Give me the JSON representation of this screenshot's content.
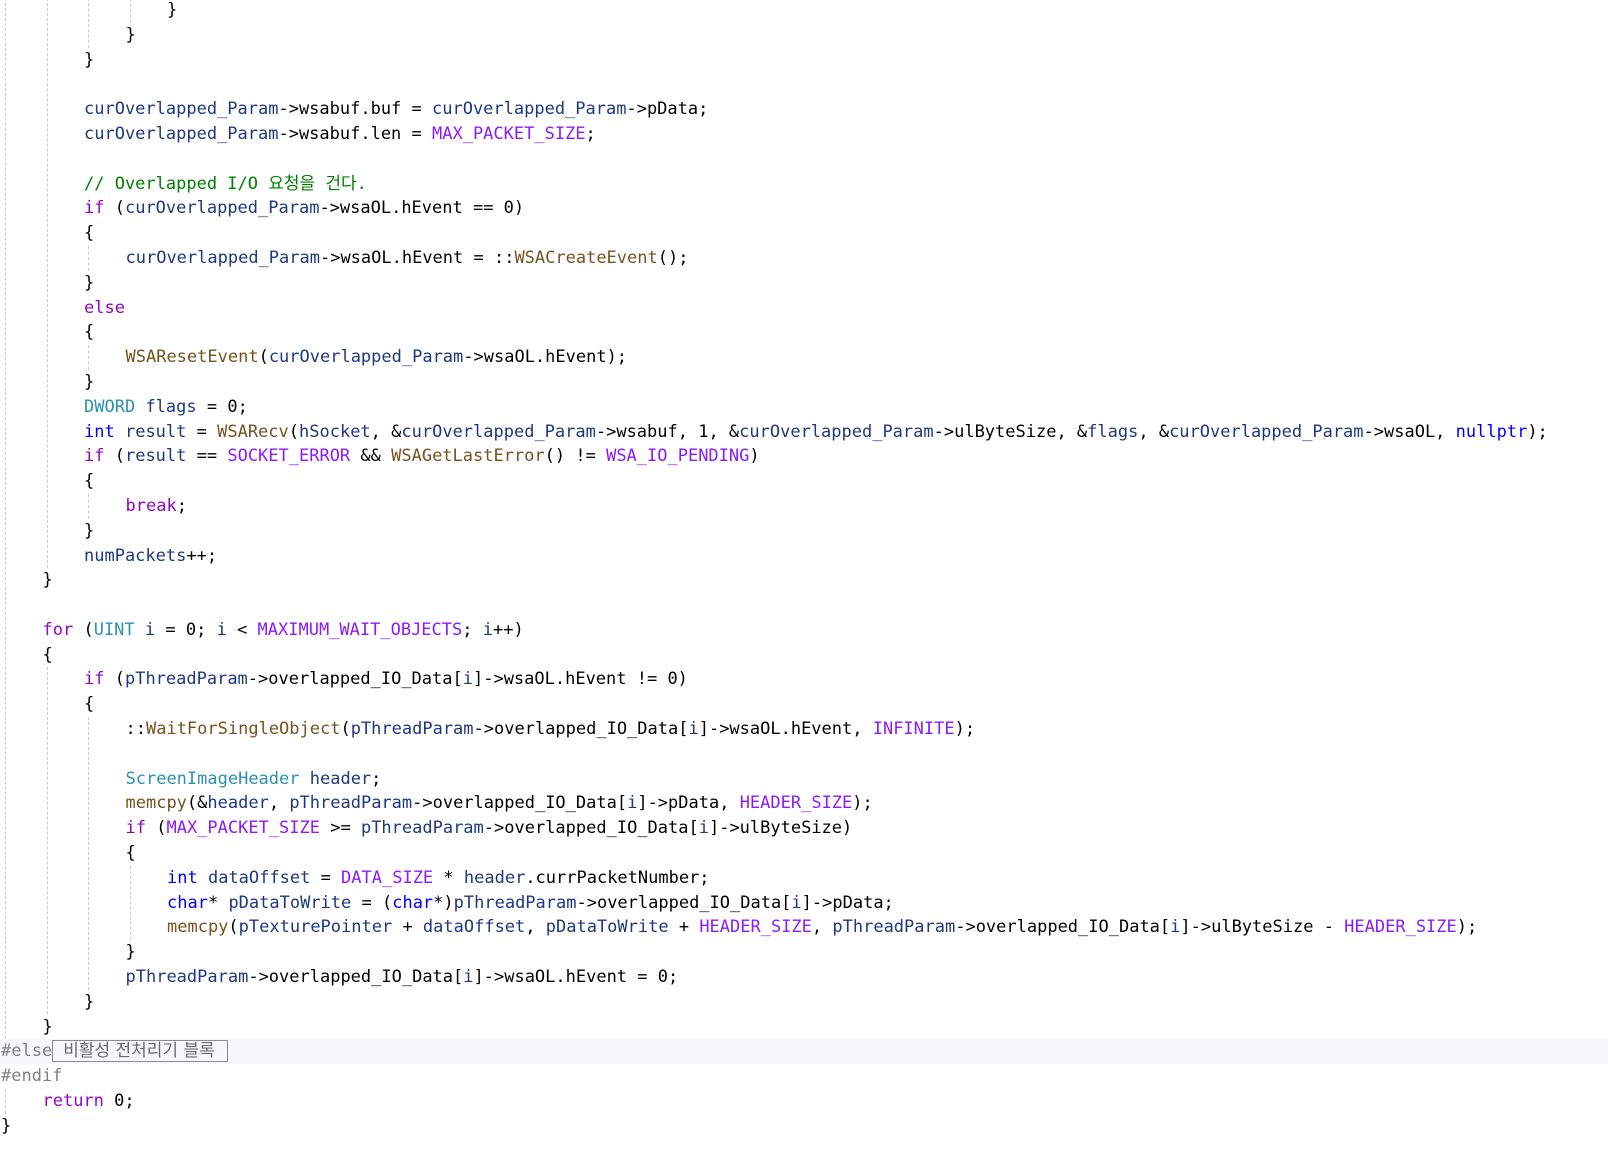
{
  "colors": {
    "plain": "#000000",
    "keyword": "#0000ff",
    "control": "#8f08c4",
    "type": "#2b91af",
    "variable": "#1f377f",
    "function": "#74531f",
    "macro": "#8a1bff",
    "comment": "#008000",
    "preprocessor": "#808080",
    "hint": "#6b6b6b",
    "number": "#000000"
  },
  "hint": {
    "label": "비활성 전처리기 블록"
  },
  "lines": [
    {
      "indent": 4,
      "tokens": [
        {
          "t": "}"
        }
      ]
    },
    {
      "indent": 3,
      "tokens": [
        {
          "t": "}"
        }
      ]
    },
    {
      "indent": 2,
      "tokens": [
        {
          "t": "}"
        }
      ]
    },
    {
      "indent": 0,
      "tokens": []
    },
    {
      "indent": 2,
      "tokens": [
        {
          "t": "curOverlapped_Param",
          "c": "variable"
        },
        {
          "t": "->wsabuf.buf = "
        },
        {
          "t": "curOverlapped_Param",
          "c": "variable"
        },
        {
          "t": "->pData;"
        }
      ]
    },
    {
      "indent": 2,
      "tokens": [
        {
          "t": "curOverlapped_Param",
          "c": "variable"
        },
        {
          "t": "->wsabuf.len = "
        },
        {
          "t": "MAX_PACKET_SIZE",
          "c": "macro"
        },
        {
          "t": ";"
        }
      ]
    },
    {
      "indent": 0,
      "tokens": []
    },
    {
      "indent": 2,
      "tokens": [
        {
          "t": "// Overlapped I/O 요청을 건다.",
          "c": "comment"
        }
      ]
    },
    {
      "indent": 2,
      "tokens": [
        {
          "t": "if",
          "c": "control"
        },
        {
          "t": " ("
        },
        {
          "t": "curOverlapped_Param",
          "c": "variable"
        },
        {
          "t": "->wsaOL.hEvent == 0)"
        }
      ]
    },
    {
      "indent": 2,
      "tokens": [
        {
          "t": "{"
        }
      ]
    },
    {
      "indent": 3,
      "tokens": [
        {
          "t": "curOverlapped_Param",
          "c": "variable"
        },
        {
          "t": "->wsaOL.hEvent = ::"
        },
        {
          "t": "WSACreateEvent",
          "c": "function"
        },
        {
          "t": "();"
        }
      ]
    },
    {
      "indent": 2,
      "tokens": [
        {
          "t": "}"
        }
      ]
    },
    {
      "indent": 2,
      "tokens": [
        {
          "t": "else",
          "c": "control"
        }
      ]
    },
    {
      "indent": 2,
      "tokens": [
        {
          "t": "{"
        }
      ]
    },
    {
      "indent": 3,
      "tokens": [
        {
          "t": "WSAResetEvent",
          "c": "function"
        },
        {
          "t": "("
        },
        {
          "t": "curOverlapped_Param",
          "c": "variable"
        },
        {
          "t": "->wsaOL.hEvent);"
        }
      ]
    },
    {
      "indent": 2,
      "tokens": [
        {
          "t": "}"
        }
      ]
    },
    {
      "indent": 2,
      "tokens": [
        {
          "t": "DWORD",
          "c": "type"
        },
        {
          "t": " "
        },
        {
          "t": "flags",
          "c": "variable"
        },
        {
          "t": " = 0;"
        }
      ]
    },
    {
      "indent": 2,
      "tokens": [
        {
          "t": "int",
          "c": "keyword"
        },
        {
          "t": " "
        },
        {
          "t": "result",
          "c": "variable"
        },
        {
          "t": " = "
        },
        {
          "t": "WSARecv",
          "c": "function"
        },
        {
          "t": "("
        },
        {
          "t": "hSocket",
          "c": "variable"
        },
        {
          "t": ", &"
        },
        {
          "t": "curOverlapped_Param",
          "c": "variable"
        },
        {
          "t": "->wsabuf, 1, &"
        },
        {
          "t": "curOverlapped_Param",
          "c": "variable"
        },
        {
          "t": "->ulByteSize, &"
        },
        {
          "t": "flags",
          "c": "variable"
        },
        {
          "t": ", &"
        },
        {
          "t": "curOverlapped_Param",
          "c": "variable"
        },
        {
          "t": "->wsaOL, "
        },
        {
          "t": "nullptr",
          "c": "keyword"
        },
        {
          "t": ");"
        }
      ]
    },
    {
      "indent": 2,
      "tokens": [
        {
          "t": "if",
          "c": "control"
        },
        {
          "t": " ("
        },
        {
          "t": "result",
          "c": "variable"
        },
        {
          "t": " == "
        },
        {
          "t": "SOCKET_ERROR",
          "c": "macro"
        },
        {
          "t": " && "
        },
        {
          "t": "WSAGetLastError",
          "c": "function"
        },
        {
          "t": "() != "
        },
        {
          "t": "WSA_IO_PENDING",
          "c": "macro"
        },
        {
          "t": ")"
        }
      ]
    },
    {
      "indent": 2,
      "tokens": [
        {
          "t": "{"
        }
      ]
    },
    {
      "indent": 3,
      "tokens": [
        {
          "t": "break",
          "c": "control"
        },
        {
          "t": ";"
        }
      ]
    },
    {
      "indent": 2,
      "tokens": [
        {
          "t": "}"
        }
      ]
    },
    {
      "indent": 2,
      "tokens": [
        {
          "t": "numPackets",
          "c": "variable"
        },
        {
          "t": "++;"
        }
      ]
    },
    {
      "indent": 1,
      "tokens": [
        {
          "t": "}"
        }
      ]
    },
    {
      "indent": 0,
      "tokens": [],
      "half": true
    },
    {
      "indent": 1,
      "tokens": [
        {
          "t": "for",
          "c": "control"
        },
        {
          "t": " ("
        },
        {
          "t": "UINT",
          "c": "type"
        },
        {
          "t": " "
        },
        {
          "t": "i",
          "c": "variable"
        },
        {
          "t": " = 0; "
        },
        {
          "t": "i",
          "c": "variable"
        },
        {
          "t": " < "
        },
        {
          "t": "MAXIMUM_WAIT_OBJECTS",
          "c": "macro"
        },
        {
          "t": "; "
        },
        {
          "t": "i",
          "c": "variable"
        },
        {
          "t": "++)"
        }
      ]
    },
    {
      "indent": 1,
      "tokens": [
        {
          "t": "{"
        }
      ]
    },
    {
      "indent": 2,
      "tokens": [
        {
          "t": "if",
          "c": "control"
        },
        {
          "t": " ("
        },
        {
          "t": "pThreadParam",
          "c": "variable"
        },
        {
          "t": "->overlapped_IO_Data["
        },
        {
          "t": "i",
          "c": "variable"
        },
        {
          "t": "]->wsaOL.hEvent != 0)"
        }
      ]
    },
    {
      "indent": 2,
      "tokens": [
        {
          "t": "{"
        }
      ]
    },
    {
      "indent": 3,
      "tokens": [
        {
          "t": "::"
        },
        {
          "t": "WaitForSingleObject",
          "c": "function"
        },
        {
          "t": "("
        },
        {
          "t": "pThreadParam",
          "c": "variable"
        },
        {
          "t": "->overlapped_IO_Data["
        },
        {
          "t": "i",
          "c": "variable"
        },
        {
          "t": "]->wsaOL.hEvent, "
        },
        {
          "t": "INFINITE",
          "c": "macro"
        },
        {
          "t": ");"
        }
      ]
    },
    {
      "indent": 0,
      "tokens": []
    },
    {
      "indent": 3,
      "tokens": [
        {
          "t": "ScreenImageHeader",
          "c": "type"
        },
        {
          "t": " "
        },
        {
          "t": "header",
          "c": "variable"
        },
        {
          "t": ";"
        }
      ]
    },
    {
      "indent": 3,
      "tokens": [
        {
          "t": "memcpy",
          "c": "function"
        },
        {
          "t": "(&"
        },
        {
          "t": "header",
          "c": "variable"
        },
        {
          "t": ", "
        },
        {
          "t": "pThreadParam",
          "c": "variable"
        },
        {
          "t": "->overlapped_IO_Data["
        },
        {
          "t": "i",
          "c": "variable"
        },
        {
          "t": "]->pData, "
        },
        {
          "t": "HEADER_SIZE",
          "c": "macro"
        },
        {
          "t": ");"
        }
      ]
    },
    {
      "indent": 3,
      "tokens": [
        {
          "t": "if",
          "c": "control"
        },
        {
          "t": " ("
        },
        {
          "t": "MAX_PACKET_SIZE",
          "c": "macro"
        },
        {
          "t": " >= "
        },
        {
          "t": "pThreadParam",
          "c": "variable"
        },
        {
          "t": "->overlapped_IO_Data["
        },
        {
          "t": "i",
          "c": "variable"
        },
        {
          "t": "]->ulByteSize)"
        }
      ]
    },
    {
      "indent": 3,
      "tokens": [
        {
          "t": "{"
        }
      ]
    },
    {
      "indent": 4,
      "tokens": [
        {
          "t": "int",
          "c": "keyword"
        },
        {
          "t": " "
        },
        {
          "t": "dataOffset",
          "c": "variable"
        },
        {
          "t": " = "
        },
        {
          "t": "DATA_SIZE",
          "c": "macro"
        },
        {
          "t": " * "
        },
        {
          "t": "header",
          "c": "variable"
        },
        {
          "t": ".currPacketNumber;"
        }
      ]
    },
    {
      "indent": 4,
      "tokens": [
        {
          "t": "char",
          "c": "keyword"
        },
        {
          "t": "* "
        },
        {
          "t": "pDataToWrite",
          "c": "variable"
        },
        {
          "t": " = ("
        },
        {
          "t": "char",
          "c": "keyword"
        },
        {
          "t": "*)"
        },
        {
          "t": "pThreadParam",
          "c": "variable"
        },
        {
          "t": "->overlapped_IO_Data["
        },
        {
          "t": "i",
          "c": "variable"
        },
        {
          "t": "]->pData;"
        }
      ]
    },
    {
      "indent": 4,
      "tokens": [
        {
          "t": "memcpy",
          "c": "function"
        },
        {
          "t": "("
        },
        {
          "t": "pTexturePointer",
          "c": "variable"
        },
        {
          "t": " + "
        },
        {
          "t": "dataOffset",
          "c": "variable"
        },
        {
          "t": ", "
        },
        {
          "t": "pDataToWrite",
          "c": "variable"
        },
        {
          "t": " + "
        },
        {
          "t": "HEADER_SIZE",
          "c": "macro"
        },
        {
          "t": ", "
        },
        {
          "t": "pThreadParam",
          "c": "variable"
        },
        {
          "t": "->overlapped_IO_Data["
        },
        {
          "t": "i",
          "c": "variable"
        },
        {
          "t": "]->ulByteSize - "
        },
        {
          "t": "HEADER_SIZE",
          "c": "macro"
        },
        {
          "t": ");"
        }
      ]
    },
    {
      "indent": 3,
      "tokens": [
        {
          "t": "}"
        }
      ]
    },
    {
      "indent": 3,
      "tokens": [
        {
          "t": "pThreadParam",
          "c": "variable"
        },
        {
          "t": "->overlapped_IO_Data["
        },
        {
          "t": "i",
          "c": "variable"
        },
        {
          "t": "]->wsaOL.hEvent = 0;"
        }
      ]
    },
    {
      "indent": 2,
      "tokens": [
        {
          "t": "}"
        }
      ]
    },
    {
      "indent": 1,
      "tokens": [
        {
          "t": "}"
        }
      ]
    },
    {
      "indent": 0,
      "tokens": [
        {
          "t": "#else",
          "c": "preprocessor"
        }
      ],
      "inactive": true,
      "hint": true
    },
    {
      "indent": 0,
      "tokens": [
        {
          "t": "#endif",
          "c": "preprocessor"
        }
      ]
    },
    {
      "indent": 1,
      "tokens": [
        {
          "t": "return",
          "c": "control"
        },
        {
          "t": " 0;"
        }
      ]
    },
    {
      "indent": 0,
      "tokens": [
        {
          "t": "}"
        }
      ]
    }
  ]
}
